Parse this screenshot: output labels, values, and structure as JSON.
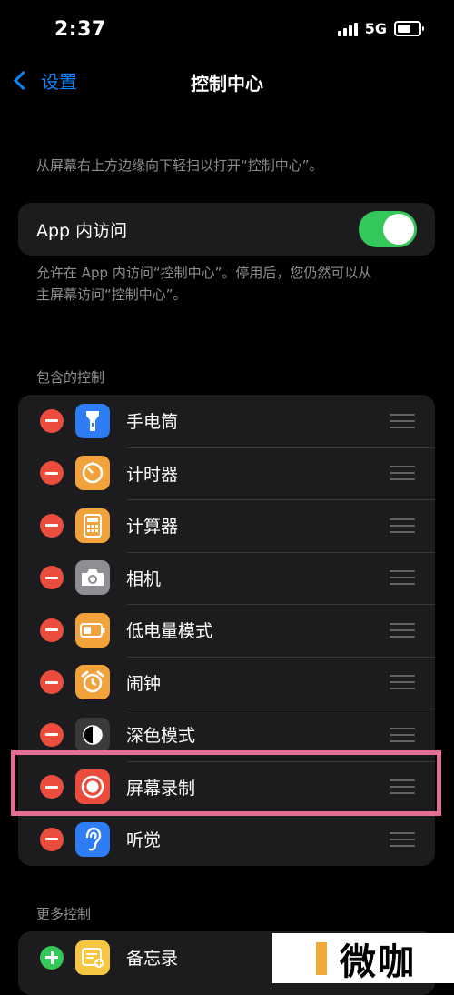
{
  "status_bar": {
    "time": "2:37",
    "network": "5G"
  },
  "nav": {
    "back_label": "设置",
    "title": "控制中心"
  },
  "intro_caption": "从屏幕右上方边缘向下轻扫以打开“控制中心”。",
  "app_access": {
    "label": "App 内访问",
    "enabled": true,
    "caption_line1": "允许在 App 内访问“控制中心”。停用后，您仍然可以从",
    "caption_line2": "主屏幕访问“控制中心”。"
  },
  "included_header": "包含的控制",
  "included_controls": [
    {
      "label": "手电筒",
      "icon": "flashlight-icon",
      "color": "#2e7cf6"
    },
    {
      "label": "计时器",
      "icon": "timer-icon",
      "color": "#f2a23a"
    },
    {
      "label": "计算器",
      "icon": "calculator-icon",
      "color": "#f2a23a"
    },
    {
      "label": "相机",
      "icon": "camera-icon",
      "color": "#8e8e93"
    },
    {
      "label": "低电量模式",
      "icon": "battery-icon",
      "color": "#f2a23a"
    },
    {
      "label": "闹钟",
      "icon": "alarm-icon",
      "color": "#f2a23a"
    },
    {
      "label": "深色模式",
      "icon": "dark-mode-icon",
      "color": "#3a3a3c"
    },
    {
      "label": "屏幕录制",
      "icon": "screen-record-icon",
      "color": "#eb4d3d"
    },
    {
      "label": "听觉",
      "icon": "ear-icon",
      "color": "#2e7cf6"
    }
  ],
  "more_header": "更多控制",
  "more_controls": [
    {
      "label": "备忘录",
      "icon": "notes-icon",
      "color": "#f7c744"
    }
  ],
  "watermark": "微咖",
  "colors": {
    "accent": "#0a84ff",
    "toggle_on": "#34c759",
    "remove": "#eb4d3d",
    "highlight": "#e56f93"
  }
}
